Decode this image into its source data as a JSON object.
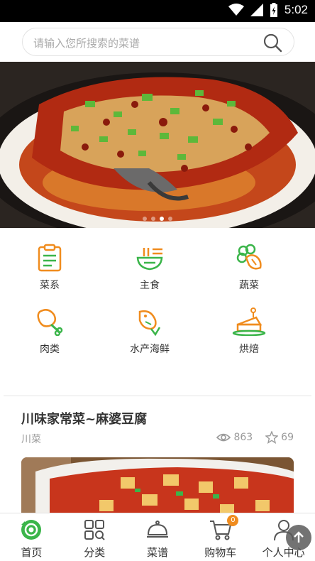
{
  "status_bar": {
    "time": "5:02"
  },
  "search": {
    "placeholder": "请输入您所搜索的菜谱"
  },
  "banner": {
    "dots_total": 4,
    "active_dot": 2
  },
  "categories": [
    {
      "label": "菜系",
      "icon": "clipboard-icon"
    },
    {
      "label": "主食",
      "icon": "noodle-bowl-icon"
    },
    {
      "label": "蔬菜",
      "icon": "vegetable-icon"
    },
    {
      "label": "肉类",
      "icon": "drumstick-icon"
    },
    {
      "label": "水产海鲜",
      "icon": "fish-icon"
    },
    {
      "label": "烘焙",
      "icon": "cake-icon"
    }
  ],
  "recipe": {
    "title": "川味家常菜~麻婆豆腐",
    "tag": "川菜",
    "views": "863",
    "favorites": "69"
  },
  "tab_bar": {
    "tabs": [
      {
        "label": "首页",
        "icon": "home-icon",
        "active": true
      },
      {
        "label": "分类",
        "icon": "category-grid-icon",
        "active": false
      },
      {
        "label": "菜谱",
        "icon": "cloche-icon",
        "active": false
      },
      {
        "label": "购物车",
        "icon": "cart-icon",
        "active": false,
        "badge": "0"
      },
      {
        "label": "个人中心",
        "icon": "user-icon",
        "active": false
      }
    ]
  },
  "colors": {
    "accent_green": "#3bb54a",
    "accent_orange": "#f08c1e"
  }
}
